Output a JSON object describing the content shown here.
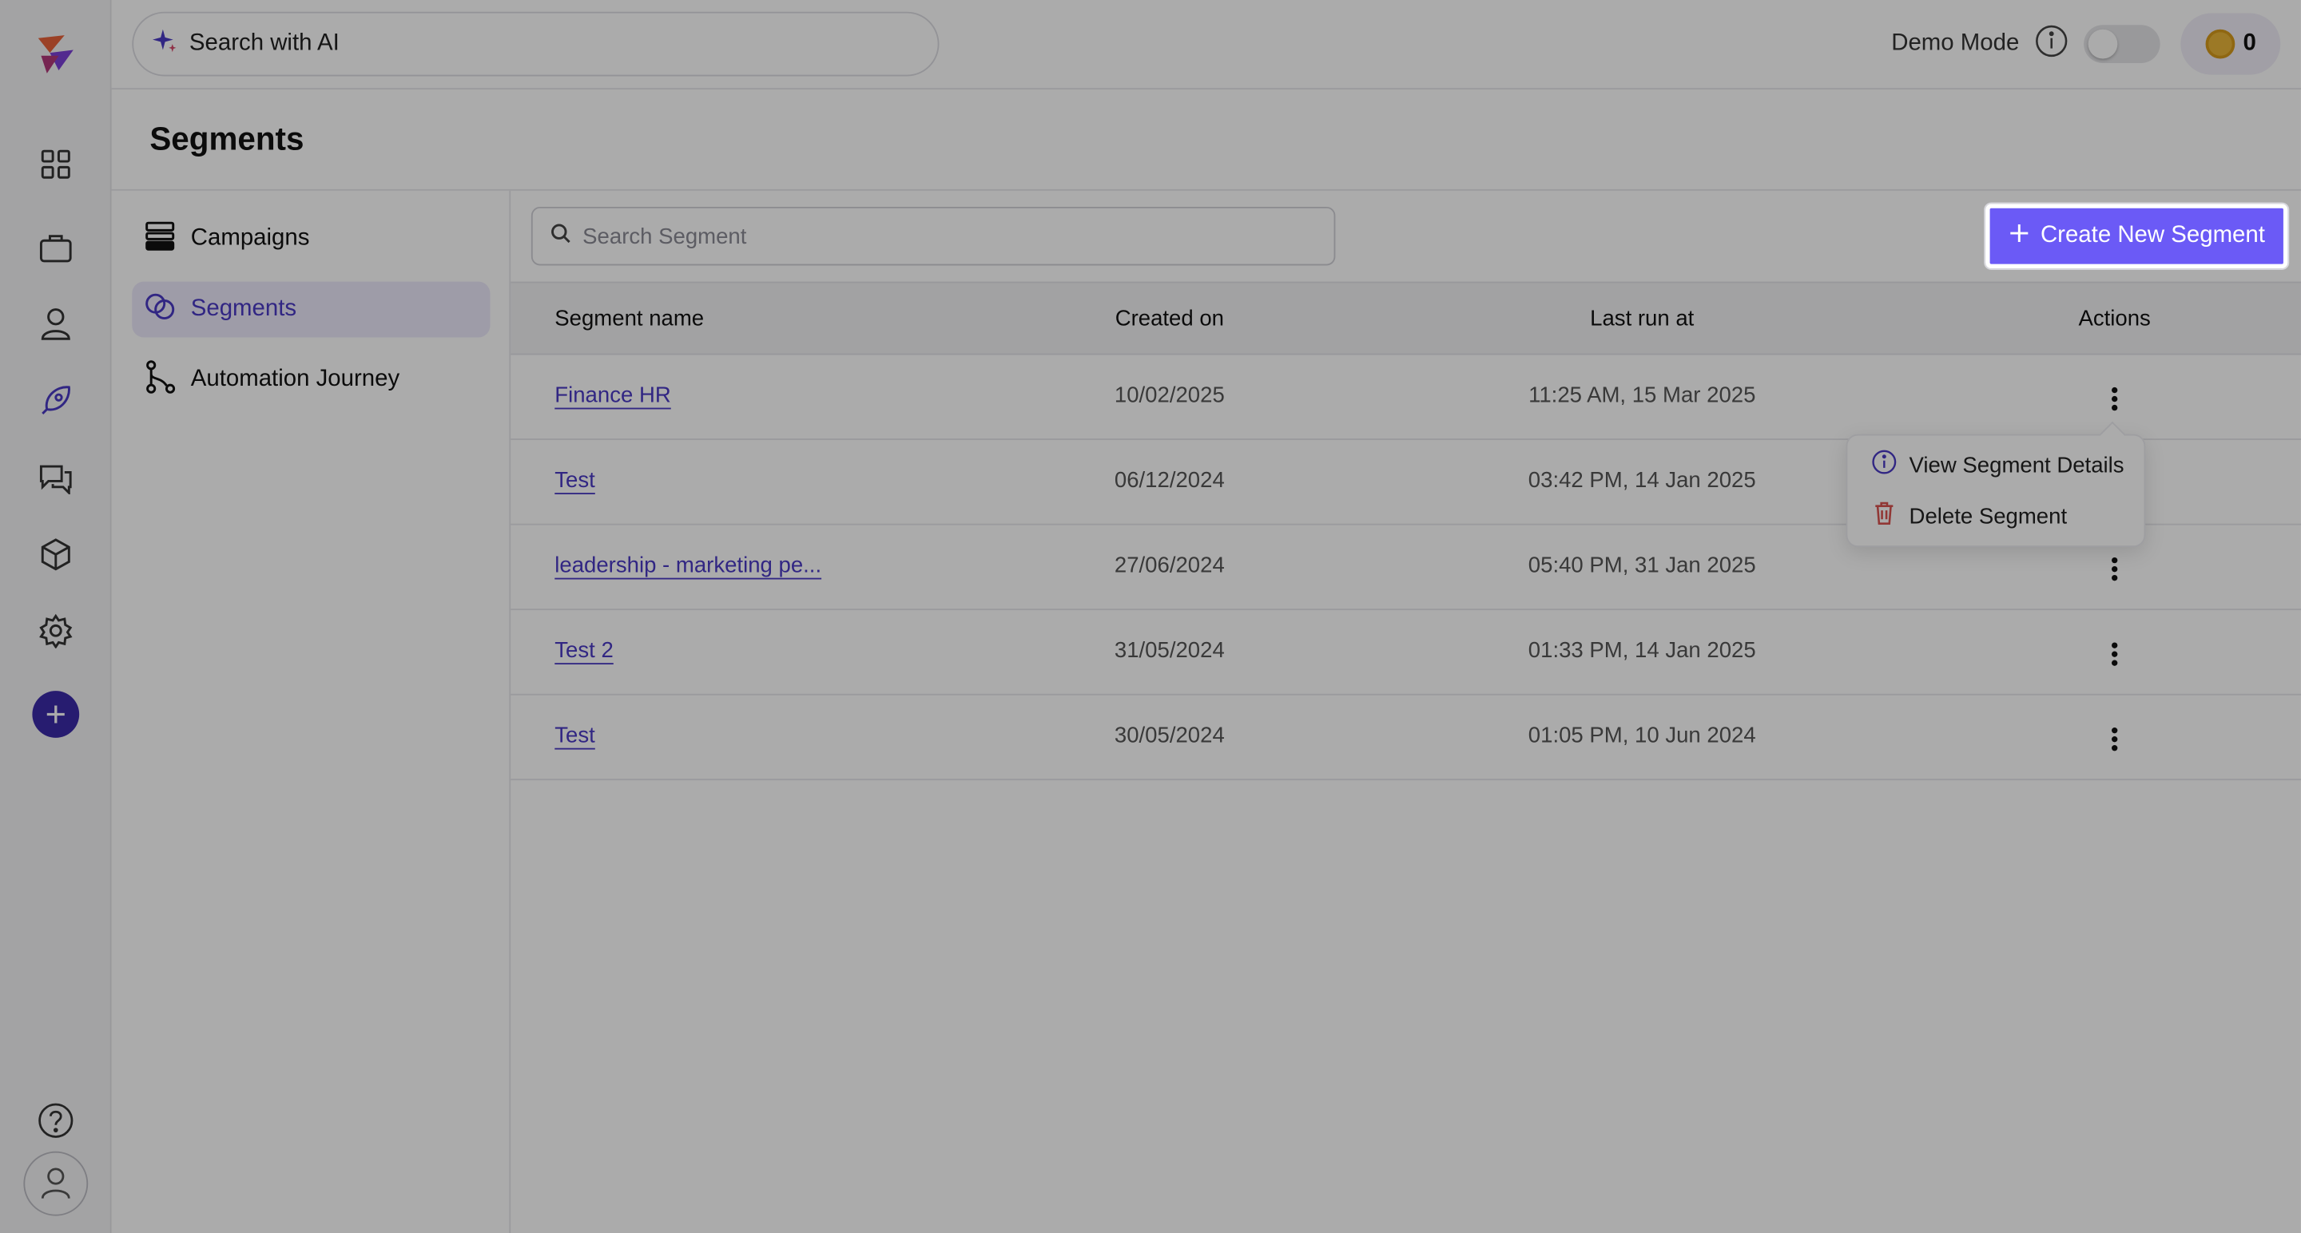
{
  "topbar": {
    "ai_search_label": "Search with AI",
    "demo_mode_label": "Demo Mode",
    "demo_mode_enabled": false,
    "credits": "0"
  },
  "rail": {
    "icons": [
      "app-logo",
      "dashboard-grid-icon",
      "briefcase-icon",
      "user-icon",
      "rocket-icon",
      "chat-icon",
      "cube-icon",
      "gear-icon",
      "add-icon",
      "help-icon",
      "avatar-icon"
    ]
  },
  "page": {
    "title": "Segments"
  },
  "subnav": {
    "items": [
      {
        "label": "Campaigns",
        "icon": "campaigns-icon",
        "active": false
      },
      {
        "label": "Segments",
        "icon": "segments-icon",
        "active": true
      },
      {
        "label": "Automation Journey",
        "icon": "journey-icon",
        "active": false
      }
    ]
  },
  "toolbar": {
    "search_placeholder": "Search Segment",
    "create_label": "Create New Segment"
  },
  "table": {
    "headers": [
      "Segment name",
      "Created on",
      "Last run at",
      "Actions"
    ],
    "rows": [
      {
        "name": "Finance HR",
        "created": "10/02/2025",
        "last_run": "11:25 AM, 15 Mar 2025"
      },
      {
        "name": "Test",
        "created": "06/12/2024",
        "last_run": "03:42 PM, 14 Jan 2025"
      },
      {
        "name": "leadership - marketing pe...",
        "created": "27/06/2024",
        "last_run": "05:40 PM, 31 Jan 2025"
      },
      {
        "name": "Test 2",
        "created": "31/05/2024",
        "last_run": "01:33 PM, 14 Jan 2025"
      },
      {
        "name": "Test",
        "created": "30/05/2024",
        "last_run": "01:05 PM, 10 Jun 2024"
      }
    ]
  },
  "actions_menu": {
    "items": [
      {
        "label": "View Segment Details",
        "icon": "info-icon"
      },
      {
        "label": "Delete Segment",
        "icon": "trash-icon"
      }
    ]
  },
  "colors": {
    "accent": "#6b5af6",
    "link": "#4a3ac4",
    "danger": "#d9534f",
    "overlay": "rgba(0,0,0,0.33)"
  }
}
